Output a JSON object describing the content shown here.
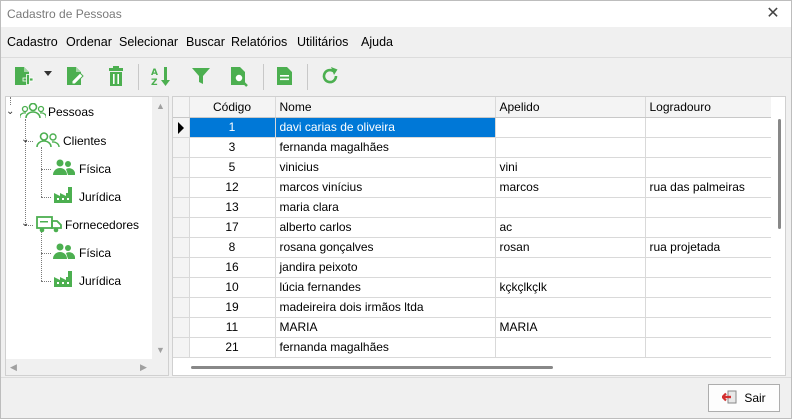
{
  "window": {
    "title": "Cadastro de Pessoas",
    "close_glyph": "✕"
  },
  "menu": [
    "Cadastro",
    "Ordenar",
    "Selecionar",
    "Buscar",
    "Relatórios",
    "Utilitários",
    "Ajuda"
  ],
  "toolbar": {
    "icons": [
      "add-document-icon",
      "edit-document-icon",
      "delete-trash-icon",
      "sort-icon",
      "filter-icon",
      "search-document-icon",
      "report-icon",
      "refresh-icon"
    ],
    "accent": "#4caf50"
  },
  "tree": {
    "root": "Pessoas",
    "clientes": "Clientes",
    "clientes_fisica": "Física",
    "clientes_juridica": "Jurídica",
    "fornecedores": "Fornecedores",
    "fornecedores_fisica": "Física",
    "fornecedores_juridica": "Jurídica"
  },
  "grid": {
    "columns": [
      "Código",
      "Nome",
      "Apelido",
      "Logradouro"
    ],
    "selected_index": 0,
    "rows": [
      {
        "codigo": "1",
        "nome": "davi carias de oliveira",
        "apelido": "",
        "logradouro": ""
      },
      {
        "codigo": "3",
        "nome": "fernanda magalhães",
        "apelido": "",
        "logradouro": ""
      },
      {
        "codigo": "5",
        "nome": "vinicius",
        "apelido": "vini",
        "logradouro": ""
      },
      {
        "codigo": "12",
        "nome": "marcos vinícius",
        "apelido": "marcos",
        "logradouro": "rua das palmeiras"
      },
      {
        "codigo": "13",
        "nome": "maria clara",
        "apelido": "",
        "logradouro": ""
      },
      {
        "codigo": "17",
        "nome": "alberto carlos",
        "apelido": "ac",
        "logradouro": ""
      },
      {
        "codigo": "8",
        "nome": "rosana gonçalves",
        "apelido": "rosan",
        "logradouro": "rua projetada"
      },
      {
        "codigo": "16",
        "nome": "jandira peixoto",
        "apelido": "",
        "logradouro": ""
      },
      {
        "codigo": "10",
        "nome": "lúcia fernandes",
        "apelido": "kçkçlkçlk",
        "logradouro": ""
      },
      {
        "codigo": "19",
        "nome": "madeireira dois irmãos ltda",
        "apelido": "",
        "logradouro": ""
      },
      {
        "codigo": "11",
        "nome": "MARIA",
        "apelido": "MARIA",
        "logradouro": ""
      },
      {
        "codigo": "21",
        "nome": "fernanda magalhães",
        "apelido": "",
        "logradouro": ""
      }
    ]
  },
  "footer": {
    "exit_label": "Sair"
  },
  "colors": {
    "selection": "#0078d7",
    "green": "#4caf50"
  }
}
